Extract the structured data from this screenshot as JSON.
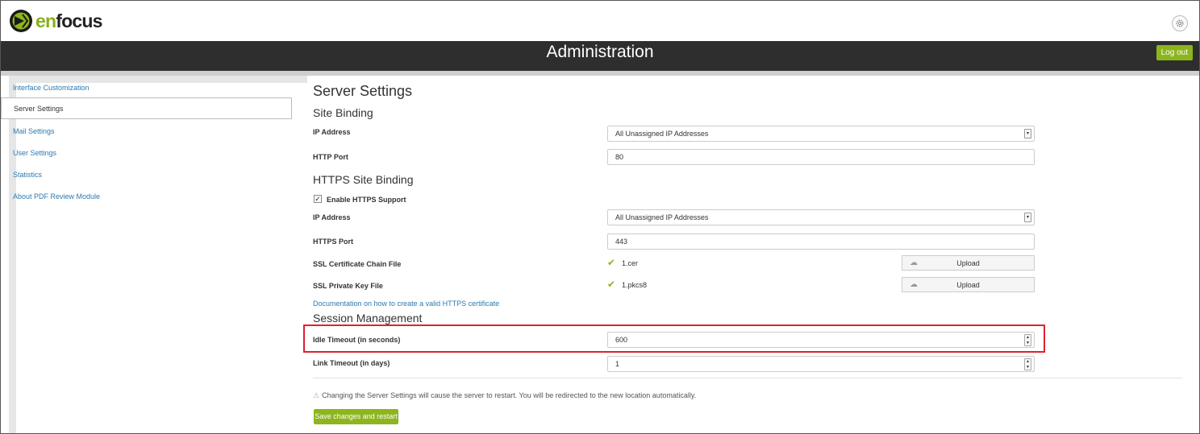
{
  "app": {
    "logo_en": "en",
    "logo_focus": "focus",
    "settings_icon": "gear-icon"
  },
  "header": {
    "title": "Administration",
    "logout_label": "Log out"
  },
  "sidebar": {
    "items": [
      {
        "label": "Interface Customization",
        "active": false
      },
      {
        "label": "Server Settings",
        "active": true
      },
      {
        "label": "Mail Settings",
        "active": false
      },
      {
        "label": "User Settings",
        "active": false
      },
      {
        "label": "Statistics",
        "active": false
      },
      {
        "label": "About PDF Review Module",
        "active": false
      }
    ]
  },
  "main": {
    "title": "Server Settings",
    "site_binding": {
      "heading": "Site Binding",
      "ip_label": "IP Address",
      "ip_value": "All Unassigned IP Addresses",
      "port_label": "HTTP Port",
      "port_value": "80"
    },
    "https_binding": {
      "heading": "HTTPS Site Binding",
      "enable_label": "Enable HTTPS Support",
      "enable_checked": true,
      "ip_label": "IP Address",
      "ip_value": "All Unassigned IP Addresses",
      "port_label": "HTTPS Port",
      "port_value": "443",
      "cert_label": "SSL Certificate Chain File",
      "cert_file": "1.cer",
      "key_label": "SSL Private Key File",
      "key_file": "1.pkcs8",
      "upload_label": "Upload",
      "doc_link": "Documentation on how to create a valid HTTPS certificate"
    },
    "session": {
      "heading": "Session Management",
      "idle_label": "Idle Timeout (in seconds)",
      "idle_value": "600",
      "link_label": "Link Timeout (in days)",
      "link_value": "1"
    },
    "warning": "Changing the Server Settings will cause the server to restart. You will be redirected to the new location automatically.",
    "save_label": "Save changes and restart"
  },
  "colors": {
    "accent": "#8db51d",
    "header_bg": "#2e2e2e",
    "link": "#2a7ab0",
    "highlight": "#e02030"
  }
}
